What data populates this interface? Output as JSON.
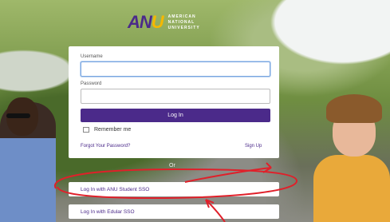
{
  "logo": {
    "mark": "ANU",
    "line1": "AMERICAN",
    "line2": "NATIONAL",
    "line3": "UNIVERSITY"
  },
  "login_form": {
    "username_label": "Username",
    "username_value": "",
    "password_label": "Password",
    "password_value": "",
    "login_button": "Log In",
    "remember_label": "Remember me",
    "forgot_link": "Forgot Your Password?",
    "signup_link": "Sign Up"
  },
  "divider_text": "Or",
  "sso": {
    "student": "Log In with ANU Student SSO",
    "educlar": "Log In with Edular SSO"
  },
  "colors": {
    "brand_purple": "#4b2a8a",
    "brand_gold": "#f5b800",
    "annotation_red": "#e0202a"
  }
}
